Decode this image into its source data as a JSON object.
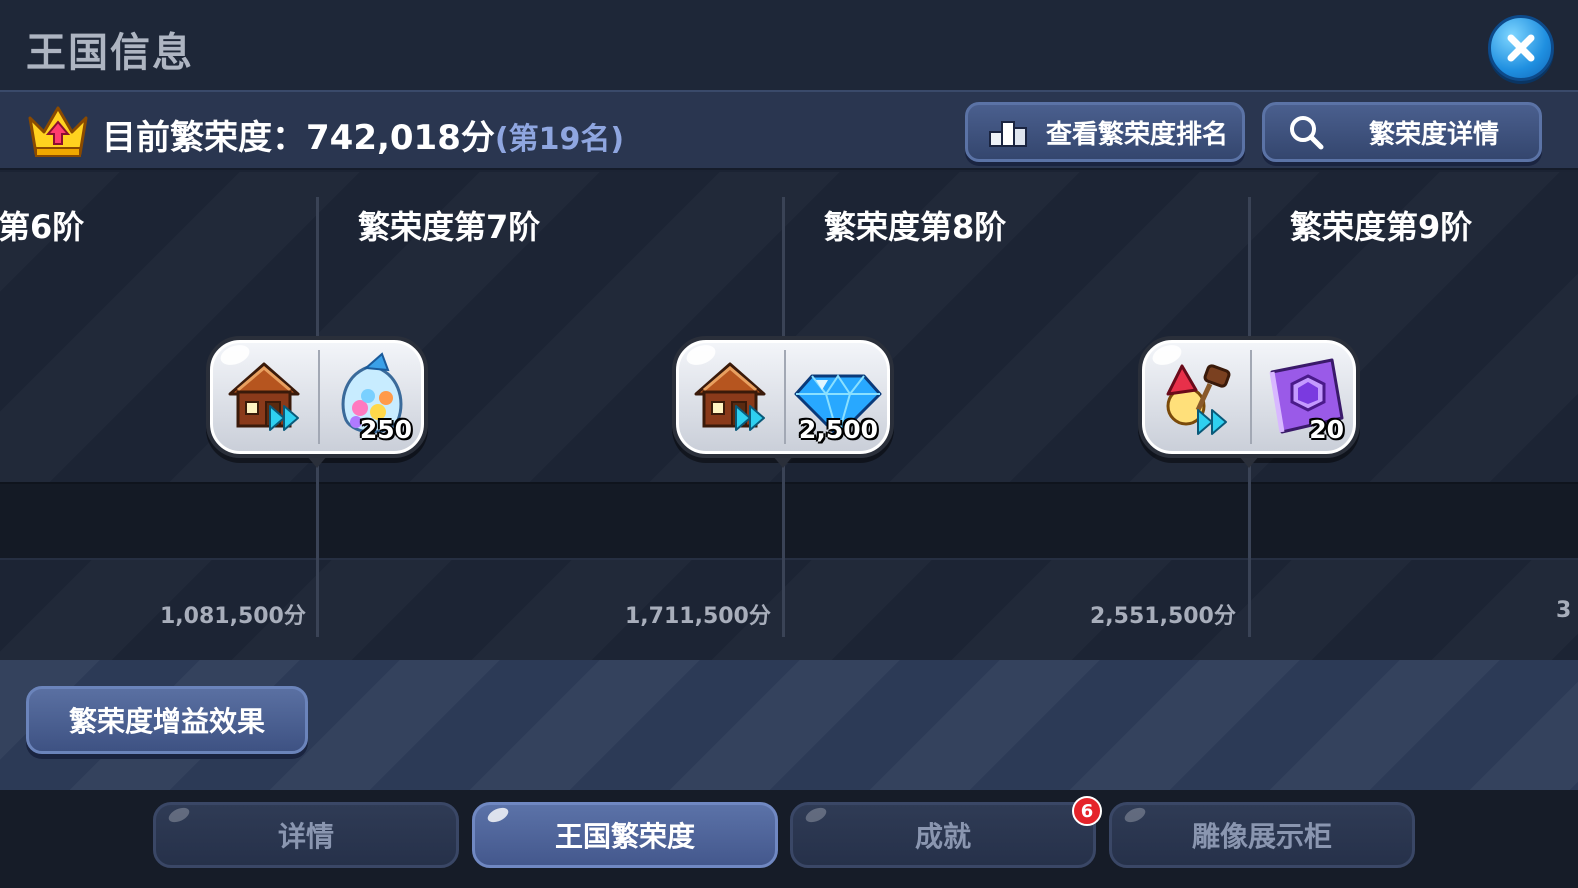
{
  "window": {
    "title": "王国信息",
    "close_icon": "close-icon"
  },
  "prosperity": {
    "label": "目前繁荣度：",
    "value": "742,018分",
    "rank": "(第19名)",
    "ranking_button": "查看繁荣度排名",
    "details_button": "繁荣度详情"
  },
  "tiers": [
    {
      "label": "第6阶",
      "score": "1,081,500分"
    },
    {
      "label": "繁荣度第7阶",
      "score": "1,711,500分",
      "reward_left_icon": "house-upgrade-icon",
      "reward_right_icon": "candy-bag-icon",
      "reward_count": "250"
    },
    {
      "label": "繁荣度第8阶",
      "score": "2,551,500分",
      "reward_left_icon": "house-upgrade-icon",
      "reward_right_icon": "crystal-gem-icon",
      "reward_count": "2,500"
    },
    {
      "label": "繁荣度第9阶",
      "score": "3",
      "reward_left_icon": "cookie-hammer-upgrade-icon",
      "reward_right_icon": "purple-book-icon",
      "reward_count": "20"
    }
  ],
  "buff_button": "繁荣度增益效果",
  "tabs": [
    {
      "label": "详情",
      "active": false
    },
    {
      "label": "王国繁荣度",
      "active": true
    },
    {
      "label": "成就",
      "active": false,
      "badge": "6"
    },
    {
      "label": "雕像展示柜",
      "active": false
    }
  ],
  "colors": {
    "background": "#1b2333",
    "accent_blue": "#4a5f8e",
    "rank_text": "#8fa6e0",
    "badge_red": "#e5242a"
  }
}
